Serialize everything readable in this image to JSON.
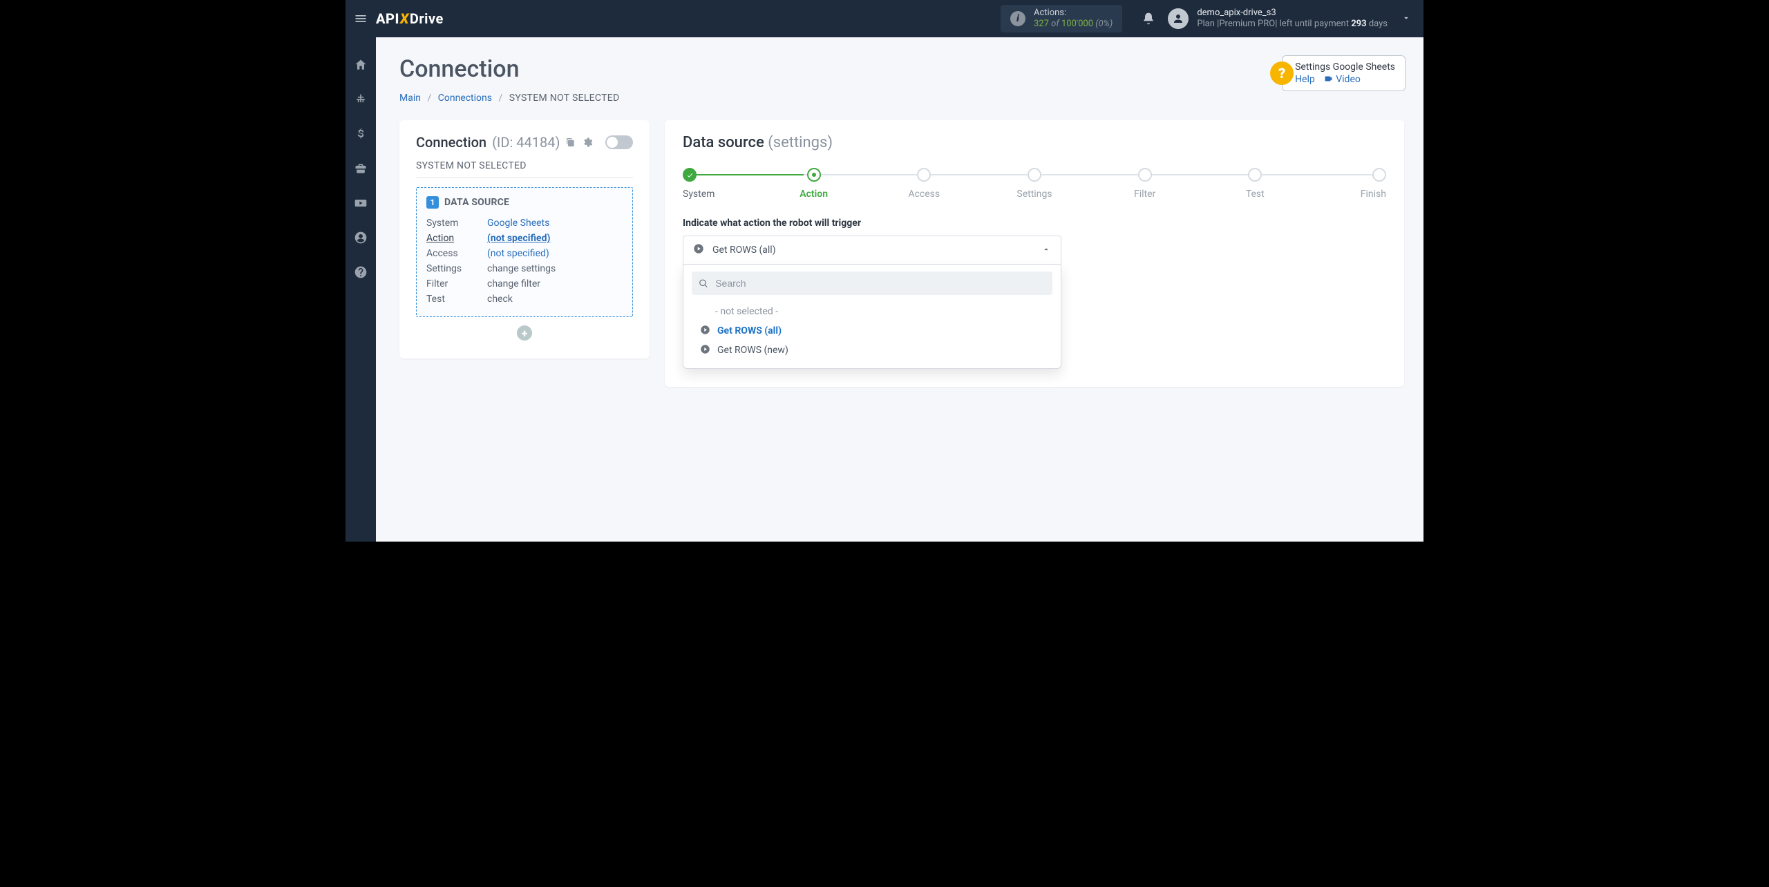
{
  "brand": {
    "api": "API",
    "x": "X",
    "drive": "Drive"
  },
  "topbar": {
    "actions_label": "Actions:",
    "actions_used": "327",
    "actions_of": "of",
    "actions_total": "100'000",
    "actions_pct": "(0%)",
    "user_name": "demo_apix-drive_s3",
    "plan_prefix": "Plan |",
    "plan_name": "Premium PRO",
    "plan_mid": "| left until payment ",
    "plan_days": "293",
    "plan_suffix": " days"
  },
  "page": {
    "title": "Connection",
    "crumb_main": "Main",
    "crumb_conn": "Connections",
    "crumb_last": "SYSTEM NOT SELECTED"
  },
  "help": {
    "title": "Settings Google Sheets",
    "help": "Help",
    "video": "Video"
  },
  "left": {
    "head": "Connection",
    "id": "(ID: 44184)",
    "sub": "SYSTEM NOT SELECTED",
    "ds_badge": "1",
    "ds_title": "DATA SOURCE",
    "rows": {
      "system_k": "System",
      "system_v": "Google Sheets",
      "action_k": "Action",
      "action_v": "(not specified)",
      "access_k": "Access",
      "access_v": "(not specified)",
      "settings_k": "Settings",
      "settings_v": "change settings",
      "filter_k": "Filter",
      "filter_v": "change filter",
      "test_k": "Test",
      "test_v": "check"
    },
    "add": "+"
  },
  "right": {
    "title": "Data source",
    "title_sub": "(settings)",
    "steps": [
      "System",
      "Action",
      "Access",
      "Settings",
      "Filter",
      "Test",
      "Finish"
    ],
    "prompt": "Indicate what action the robot will trigger",
    "selected": "Get ROWS (all)",
    "search_ph": "Search",
    "options": {
      "ns": "- not selected -",
      "o1": "Get ROWS (all)",
      "o2": "Get ROWS (new)"
    }
  }
}
